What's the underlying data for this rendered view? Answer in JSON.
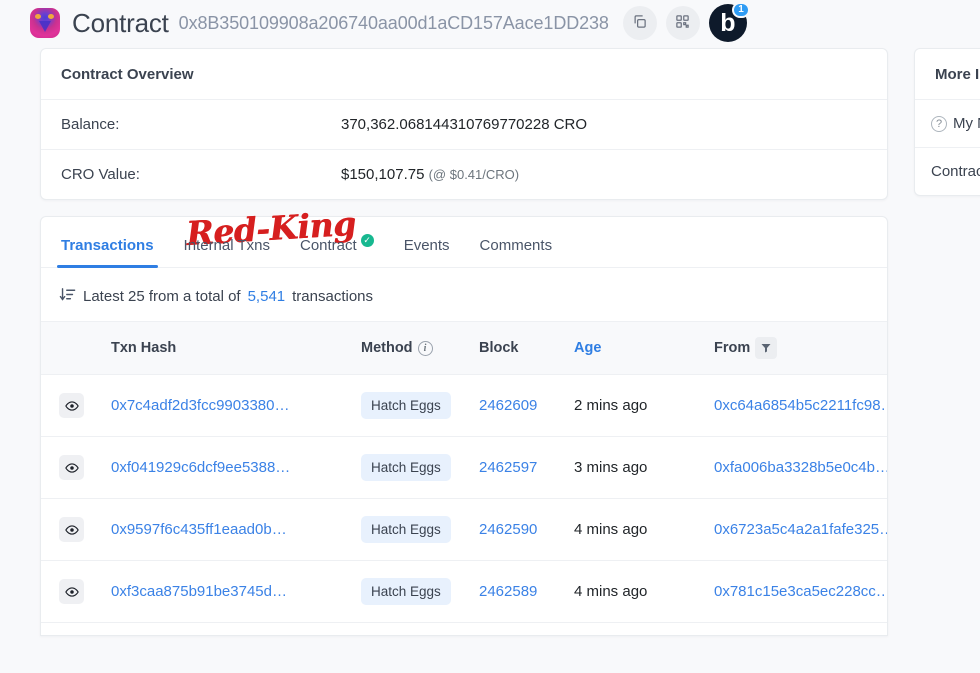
{
  "header": {
    "logo_icon": "token-logo-icon",
    "title": "Contract",
    "address": "0x8B350109908a206740aa00d1aCD157Aace1DD238",
    "copy_icon": "copy-icon",
    "qr_icon": "qr-code-icon",
    "badge_letter": "b",
    "badge_count": "1"
  },
  "overview": {
    "title": "Contract Overview",
    "balance_label": "Balance:",
    "balance_value": "370,362.068144310769770228 CRO",
    "cro_value_label": "CRO Value:",
    "cro_value_amount": "$150,107.75",
    "cro_value_rate": "(@ $0.41/CRO)"
  },
  "more_info": {
    "title": "More Info",
    "name_tag_label": "My Name Tag",
    "help_icon": "question-mark-icon",
    "contract_label": "Contract"
  },
  "watermark": {
    "text": "Red-King",
    "color": "#d61f1f"
  },
  "tabs": [
    {
      "label": "Transactions",
      "active": true,
      "verified": false
    },
    {
      "label": "Internal Txns",
      "active": false,
      "verified": false
    },
    {
      "label": "Contract",
      "active": false,
      "verified": true
    },
    {
      "label": "Events",
      "active": false,
      "verified": false
    },
    {
      "label": "Comments",
      "active": false,
      "verified": false
    }
  ],
  "summary": {
    "sort_icon": "sort-descending-icon",
    "prefix": "Latest 25 from a total of",
    "count": "5,541",
    "suffix": "transactions"
  },
  "table": {
    "columns": {
      "eye": "",
      "txn_hash": "Txn Hash",
      "method": "Method",
      "method_info_icon": "info-icon",
      "block": "Block",
      "age": "Age",
      "from": "From",
      "from_filter_icon": "filter-icon"
    },
    "rows": [
      {
        "eye_icon": "eye-icon",
        "txn_hash": "0x7c4adf2d3fcc9903380…",
        "method": "Hatch Eggs",
        "block": "2462609",
        "age": "2 mins ago",
        "from": "0xc64a6854b5c2211fc98…"
      },
      {
        "eye_icon": "eye-icon",
        "txn_hash": "0xf041929c6dcf9ee5388…",
        "method": "Hatch Eggs",
        "block": "2462597",
        "age": "3 mins ago",
        "from": "0xfa006ba3328b5e0c4b…"
      },
      {
        "eye_icon": "eye-icon",
        "txn_hash": "0x9597f6c435ff1eaad0b…",
        "method": "Hatch Eggs",
        "block": "2462590",
        "age": "4 mins ago",
        "from": "0x6723a5c4a2a1fafe325…"
      },
      {
        "eye_icon": "eye-icon",
        "txn_hash": "0xf3caa875b91be3745d…",
        "method": "Hatch Eggs",
        "block": "2462589",
        "age": "4 mins ago",
        "from": "0x781c15e3ca5ec228cc…"
      }
    ]
  },
  "colors": {
    "accent": "#2f7ee3",
    "link": "#3b82e6",
    "verified": "#17b890",
    "method_badge_bg": "#e8f1fd",
    "page_bg": "#f8f9fb"
  }
}
